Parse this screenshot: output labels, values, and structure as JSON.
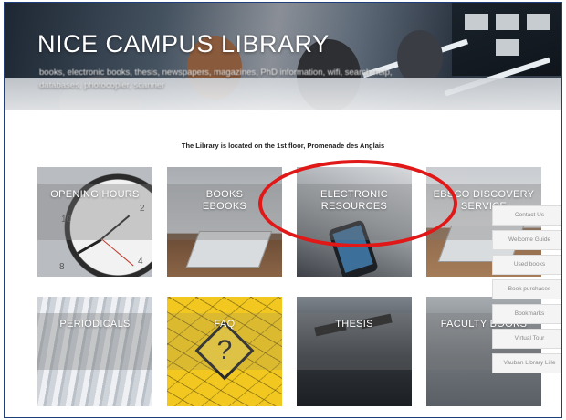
{
  "header": {
    "title": "NICE CAMPUS LIBRARY",
    "subtitle": "books, electronic books, thesis, newspapers, magazines, PhD information, wifi, search help, databases, photocopier, scanner"
  },
  "location_text": "The Library is located on the 1st floor, Promenade des Anglais",
  "tiles": [
    {
      "label": "OPENING HOURS"
    },
    {
      "label": "BOOKS EBOOKS"
    },
    {
      "label": "ELECTRONIC RESOURCES"
    },
    {
      "label": "EBSCO DISCOVERY SERVICE"
    },
    {
      "label": "PERIODICALS"
    },
    {
      "label": "FAQ"
    },
    {
      "label": "THESIS"
    },
    {
      "label": "FACULTY BOOKS"
    }
  ],
  "side_menu": [
    "Contact Us",
    "Welcome Guide",
    "Used books",
    "Book purchases",
    "Bookmarks",
    "Virtual Tour",
    "Vauban Library Lille"
  ],
  "annotation_color": "#e01818",
  "faq_glyph": "?",
  "clock_numbers": [
    "10",
    "2",
    "8",
    "4"
  ]
}
